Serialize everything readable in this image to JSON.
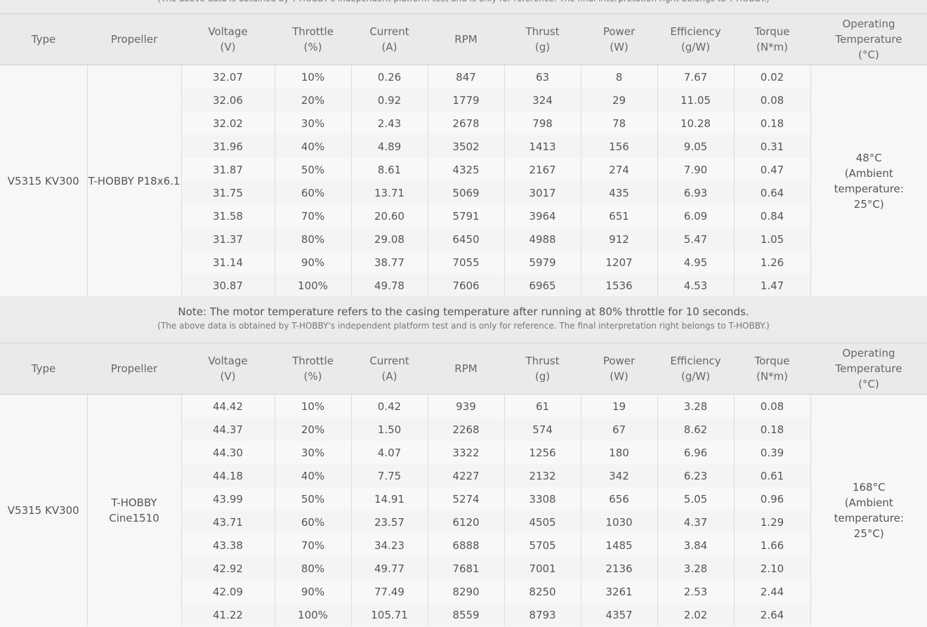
{
  "top_note": {
    "reference": "(The above data is obtained by T-HOBBY's independent platform test and is only for reference. The final interpretation right belongs to T-HOBBY.)"
  },
  "headers": [
    [
      "Type"
    ],
    [
      "Propeller"
    ],
    [
      "Voltage",
      "(V)"
    ],
    [
      "Throttle",
      "(%)"
    ],
    [
      "Current",
      "(A)"
    ],
    [
      "RPM"
    ],
    [
      "Thrust",
      "(g)"
    ],
    [
      "Power",
      "(W)"
    ],
    [
      "Efficiency",
      "(g/W)"
    ],
    [
      "Torque",
      "(N*m)"
    ],
    [
      "Operating",
      "Temperature",
      "(°C)"
    ]
  ],
  "middle_note": {
    "note": "Note: The motor temperature refers to the casing temperature after running at 80% throttle for 10 seconds.",
    "reference": "(The above data is obtained by T-HOBBY's independent platform test and is only for reference. The final interpretation right belongs to T-HOBBY.)"
  },
  "tables": [
    {
      "type": "V5315 KV300",
      "propeller": [
        "T-HOBBY P18x6.1"
      ],
      "temperature": [
        "48°C",
        "(Ambient",
        "temperature:",
        "25°C)"
      ],
      "rows": [
        [
          "32.07",
          "10%",
          "0.26",
          "847",
          "63",
          "8",
          "7.67",
          "0.02"
        ],
        [
          "32.06",
          "20%",
          "0.92",
          "1779",
          "324",
          "29",
          "11.05",
          "0.08"
        ],
        [
          "32.02",
          "30%",
          "2.43",
          "2678",
          "798",
          "78",
          "10.28",
          "0.18"
        ],
        [
          "31.96",
          "40%",
          "4.89",
          "3502",
          "1413",
          "156",
          "9.05",
          "0.31"
        ],
        [
          "31.87",
          "50%",
          "8.61",
          "4325",
          "2167",
          "274",
          "7.90",
          "0.47"
        ],
        [
          "31.75",
          "60%",
          "13.71",
          "5069",
          "3017",
          "435",
          "6.93",
          "0.64"
        ],
        [
          "31.58",
          "70%",
          "20.60",
          "5791",
          "3964",
          "651",
          "6.09",
          "0.84"
        ],
        [
          "31.37",
          "80%",
          "29.08",
          "6450",
          "4988",
          "912",
          "5.47",
          "1.05"
        ],
        [
          "31.14",
          "90%",
          "38.77",
          "7055",
          "5979",
          "1207",
          "4.95",
          "1.26"
        ],
        [
          "30.87",
          "100%",
          "49.78",
          "7606",
          "6965",
          "1536",
          "4.53",
          "1.47"
        ]
      ]
    },
    {
      "type": "V5315 KV300",
      "propeller": [
        "T-HOBBY",
        "Cine1510"
      ],
      "temperature": [
        "168°C",
        "(Ambient",
        "temperature:",
        "25°C)"
      ],
      "rows": [
        [
          "44.42",
          "10%",
          "0.42",
          "939",
          "61",
          "19",
          "3.28",
          "0.08"
        ],
        [
          "44.37",
          "20%",
          "1.50",
          "2268",
          "574",
          "67",
          "8.62",
          "0.18"
        ],
        [
          "44.30",
          "30%",
          "4.07",
          "3322",
          "1256",
          "180",
          "6.96",
          "0.39"
        ],
        [
          "44.18",
          "40%",
          "7.75",
          "4227",
          "2132",
          "342",
          "6.23",
          "0.61"
        ],
        [
          "43.99",
          "50%",
          "14.91",
          "5274",
          "3308",
          "656",
          "5.05",
          "0.96"
        ],
        [
          "43.71",
          "60%",
          "23.57",
          "6120",
          "4505",
          "1030",
          "4.37",
          "1.29"
        ],
        [
          "43.38",
          "70%",
          "34.23",
          "6888",
          "5705",
          "1485",
          "3.84",
          "1.66"
        ],
        [
          "42.92",
          "80%",
          "49.77",
          "7681",
          "7001",
          "2136",
          "3.28",
          "2.10"
        ],
        [
          "42.09",
          "90%",
          "77.49",
          "8290",
          "8250",
          "3261",
          "2.53",
          "2.44"
        ],
        [
          "41.22",
          "100%",
          "105.71",
          "8559",
          "8793",
          "4357",
          "2.02",
          "2.64"
        ]
      ]
    }
  ]
}
